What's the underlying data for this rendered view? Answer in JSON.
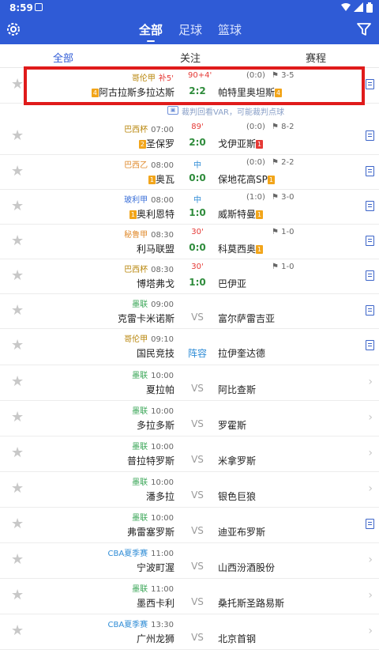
{
  "statusbar": {
    "time": "8:59"
  },
  "appbar": {
    "tabs": [
      {
        "label": "全部"
      },
      {
        "label": "足球"
      },
      {
        "label": "篮球"
      }
    ]
  },
  "subtabs": [
    {
      "label": "全部"
    },
    {
      "label": "关注"
    },
    {
      "label": "赛程"
    }
  ],
  "var_note": "裁判回看VAR，可能裁判点球",
  "matches": [
    {
      "league": "哥伦甲",
      "league_color": "#b8860b",
      "time": "补5'",
      "time_color": "#e53935",
      "minute": "90+4'",
      "minute_color": "#e53935",
      "ht": "(0:0)",
      "corner": "3-5",
      "home": "阿古拉斯多拉达斯",
      "home_badge": "4",
      "home_badge_type": "y",
      "score": "2:2",
      "score_type": "live",
      "away": "帕特里奥坦斯",
      "away_badge": "4",
      "away_badge_type": "y",
      "end_icon": "doc"
    },
    {
      "league": "巴西杯",
      "league_color": "#b8860b",
      "time": "07:00",
      "minute": "89'",
      "minute_color": "#e53935",
      "ht": "(0:0)",
      "corner": "8-2",
      "home": "圣保罗",
      "home_badge": "2",
      "home_badge_type": "y",
      "score": "2:0",
      "score_type": "live",
      "away": "戈伊亚斯",
      "away_badge": "1",
      "away_badge_type": "r",
      "end_icon": "doc"
    },
    {
      "league": "巴西乙",
      "league_color": "#e08a2c",
      "time": "08:00",
      "minute": "中",
      "minute_color": "#2f8cd6",
      "ht": "(0:0)",
      "corner": "2-2",
      "home": "奥瓦",
      "home_badge": "1",
      "home_badge_type": "y",
      "score": "0:0",
      "score_type": "live",
      "away": "保地花高SP",
      "away_badge": "1",
      "away_badge_type": "y",
      "end_icon": "doc"
    },
    {
      "league": "玻利甲",
      "league_color": "#3a6fd8",
      "time": "08:00",
      "minute": "中",
      "minute_color": "#2f8cd6",
      "ht": "(1:0)",
      "corner": "3-0",
      "home": "奥利恩特",
      "home_badge": "1",
      "home_badge_type": "y",
      "score": "1:0",
      "score_type": "live",
      "away": "威斯特曼",
      "away_badge": "1",
      "away_badge_type": "y",
      "end_icon": "doc"
    },
    {
      "league": "秘鲁甲",
      "league_color": "#e08a2c",
      "time": "08:30",
      "minute": "30'",
      "minute_color": "#e53935",
      "ht": "",
      "corner": "1-0",
      "home": "利马联盟",
      "home_badge": "",
      "home_badge_type": "",
      "score": "0:0",
      "score_type": "live",
      "away": "科莫西奥",
      "away_badge": "1",
      "away_badge_type": "y",
      "end_icon": "doc"
    },
    {
      "league": "巴西杯",
      "league_color": "#b8860b",
      "time": "08:30",
      "minute": "30'",
      "minute_color": "#e53935",
      "ht": "",
      "corner": "1-0",
      "home": "博塔弗戈",
      "home_badge": "",
      "home_badge_type": "",
      "score": "1:0",
      "score_type": "live",
      "away": "巴伊亚",
      "away_badge": "",
      "away_badge_type": "",
      "end_icon": "doc"
    },
    {
      "league": "墨联",
      "league_color": "#3aa657",
      "time": "09:00",
      "minute": "",
      "minute_color": "#000",
      "ht": "",
      "corner": "",
      "home": "克雷卡米诺斯",
      "home_badge": "",
      "home_badge_type": "",
      "score": "VS",
      "score_type": "vs",
      "away": "富尔萨雷吉亚",
      "away_badge": "",
      "away_badge_type": "",
      "end_icon": "doc"
    },
    {
      "league": "哥伦甲",
      "league_color": "#b8860b",
      "time": "09:10",
      "minute": "",
      "minute_color": "#000",
      "ht": "",
      "corner": "",
      "home": "国民竞技",
      "home_badge": "",
      "home_badge_type": "",
      "score": "阵容",
      "score_type": "lineup",
      "away": "拉伊奎达德",
      "away_badge": "",
      "away_badge_type": "",
      "end_icon": "doc"
    },
    {
      "league": "墨联",
      "league_color": "#3aa657",
      "time": "10:00",
      "minute": "",
      "minute_color": "#000",
      "ht": "",
      "corner": "",
      "home": "夏拉帕",
      "home_badge": "",
      "home_badge_type": "",
      "score": "VS",
      "score_type": "vs",
      "away": "阿比查斯",
      "away_badge": "",
      "away_badge_type": "",
      "end_icon": "chev"
    },
    {
      "league": "墨联",
      "league_color": "#3aa657",
      "time": "10:00",
      "minute": "",
      "minute_color": "#000",
      "ht": "",
      "corner": "",
      "home": "多拉多斯",
      "home_badge": "",
      "home_badge_type": "",
      "score": "VS",
      "score_type": "vs",
      "away": "罗霍斯",
      "away_badge": "",
      "away_badge_type": "",
      "end_icon": "chev"
    },
    {
      "league": "墨联",
      "league_color": "#3aa657",
      "time": "10:00",
      "minute": "",
      "minute_color": "#000",
      "ht": "",
      "corner": "",
      "home": "普拉特罗斯",
      "home_badge": "",
      "home_badge_type": "",
      "score": "VS",
      "score_type": "vs",
      "away": "米拿罗斯",
      "away_badge": "",
      "away_badge_type": "",
      "end_icon": "chev"
    },
    {
      "league": "墨联",
      "league_color": "#3aa657",
      "time": "10:00",
      "minute": "",
      "minute_color": "#000",
      "ht": "",
      "corner": "",
      "home": "潘多拉",
      "home_badge": "",
      "home_badge_type": "",
      "score": "VS",
      "score_type": "vs",
      "away": "银色巨狼",
      "away_badge": "",
      "away_badge_type": "",
      "end_icon": "chev"
    },
    {
      "league": "墨联",
      "league_color": "#3aa657",
      "time": "10:00",
      "minute": "",
      "minute_color": "#000",
      "ht": "",
      "corner": "",
      "home": "弗雷塞罗斯",
      "home_badge": "",
      "home_badge_type": "",
      "score": "VS",
      "score_type": "vs",
      "away": "迪亚布罗斯",
      "away_badge": "",
      "away_badge_type": "",
      "end_icon": "doc"
    },
    {
      "league": "CBA夏季赛",
      "league_color": "#2f8cd6",
      "time": "11:00",
      "minute": "",
      "minute_color": "#000",
      "ht": "",
      "corner": "",
      "home": "宁波町渥",
      "home_badge": "",
      "home_badge_type": "",
      "score": "VS",
      "score_type": "vs",
      "away": "山西汾酒股份",
      "away_badge": "",
      "away_badge_type": "",
      "end_icon": "chev"
    },
    {
      "league": "墨联",
      "league_color": "#3aa657",
      "time": "11:00",
      "minute": "",
      "minute_color": "#000",
      "ht": "",
      "corner": "",
      "home": "墨西卡利",
      "home_badge": "",
      "home_badge_type": "",
      "score": "VS",
      "score_type": "vs",
      "away": "桑托斯圣路易斯",
      "away_badge": "",
      "away_badge_type": "",
      "end_icon": "chev"
    },
    {
      "league": "CBA夏季赛",
      "league_color": "#2f8cd6",
      "time": "13:30",
      "minute": "",
      "minute_color": "#000",
      "ht": "",
      "corner": "",
      "home": "广州龙狮",
      "home_badge": "",
      "home_badge_type": "",
      "score": "VS",
      "score_type": "vs",
      "away": "北京首钢",
      "away_badge": "",
      "away_badge_type": "",
      "end_icon": "chev"
    }
  ]
}
